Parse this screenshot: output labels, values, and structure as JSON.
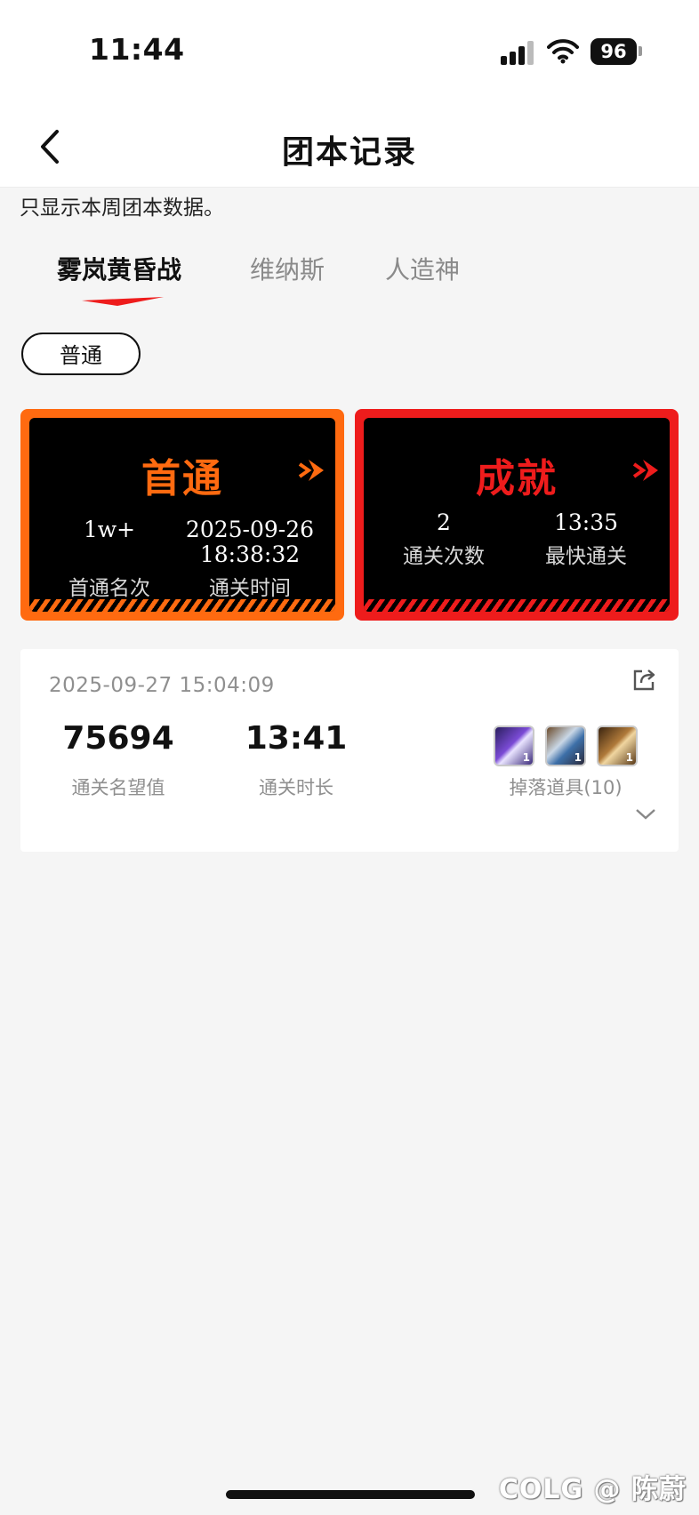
{
  "status_bar": {
    "time": "11:44",
    "battery": "96"
  },
  "header": {
    "title": "团本记录"
  },
  "notice": "只显示本周团本数据。",
  "tabs": [
    {
      "label": "雾岚黄昏战",
      "active": true
    },
    {
      "label": "维纳斯",
      "active": false
    },
    {
      "label": "人造神",
      "active": false
    }
  ],
  "difficulty": "普通",
  "first_clear_card": {
    "title": "首通",
    "rank_value": "1w+",
    "rank_label": "首通名次",
    "date": "2025-09-26",
    "clock": "18:38:32",
    "time_label": "通关时间"
  },
  "achievement_card": {
    "title": "成就",
    "count_value": "2",
    "count_label": "通关次数",
    "fastest_value": "13:35",
    "fastest_label": "最快通关"
  },
  "record": {
    "timestamp": "2025-09-27 15:04:09",
    "reputation": "75694",
    "reputation_label": "通关名望值",
    "duration": "13:41",
    "duration_label": "通关时长",
    "drops_label": "掉落道具(10)",
    "items": [
      {
        "icon": "purple-armor-item-icon",
        "qty": "1"
      },
      {
        "icon": "blue-armor-item-icon",
        "qty": "1"
      },
      {
        "icon": "gold-boots-item-icon",
        "qty": "1"
      }
    ]
  },
  "watermark": "COLG @ 陈蔚",
  "colors": {
    "orange": "#ff6a10",
    "red": "#ee1c1c",
    "background": "#f5f5f5"
  }
}
